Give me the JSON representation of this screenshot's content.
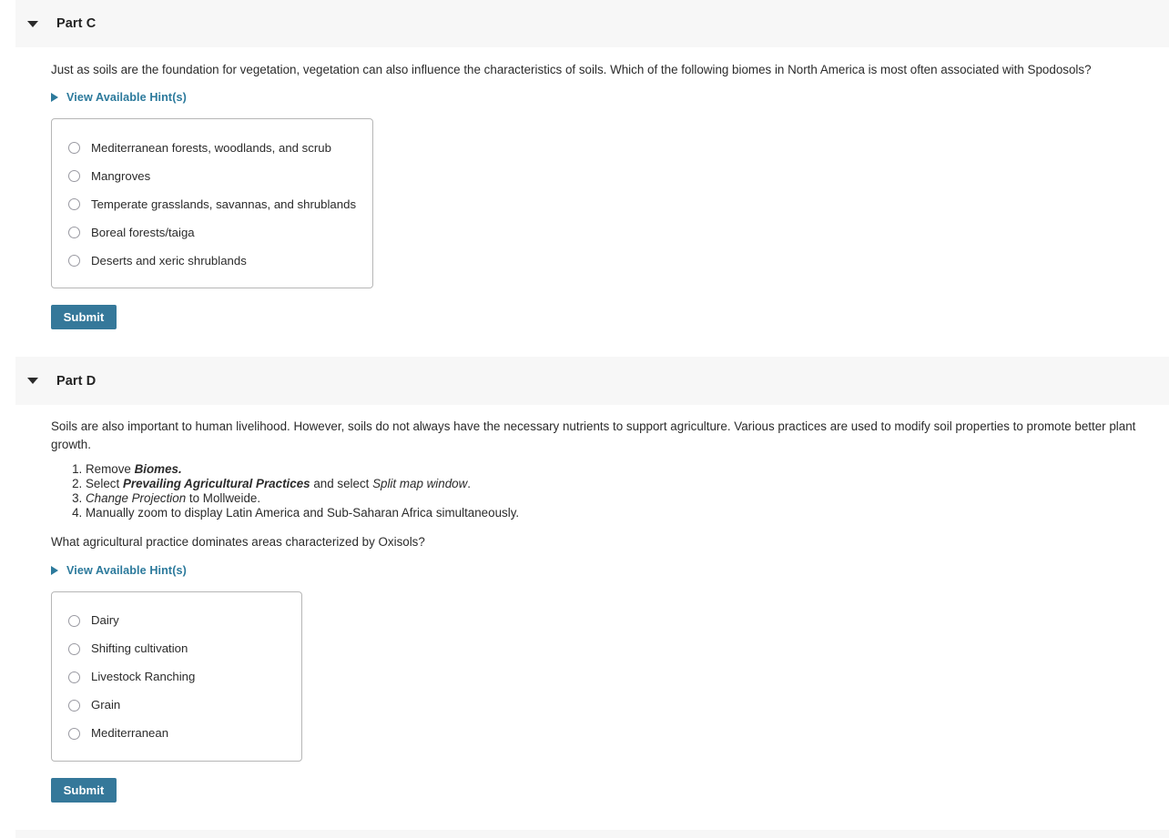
{
  "parts": [
    {
      "id": "part-c",
      "title": "Part C",
      "collapse_icon": "chevron-down-icon",
      "question": "Just as soils are the foundation for vegetation, vegetation can also influence the characteristics of soils. Which of the following biomes in North America is most often associated with Spodosols?",
      "hint": {
        "icon": "triangle-right-icon",
        "label": "View Available Hint(s)"
      },
      "options": [
        "Mediterranean forests, woodlands, and scrub",
        "Mangroves",
        "Temperate grasslands, savannas, and shrublands",
        "Boreal forests/taiga",
        "Deserts and xeric shrublands"
      ],
      "submit_label": "Submit"
    },
    {
      "id": "part-d",
      "title": "Part D",
      "collapse_icon": "chevron-down-icon",
      "intro": "Soils are also important to human livelihood. However, soils do not always have the necessary nutrients to support agriculture. Various practices are used to modify soil properties to promote better plant growth.",
      "instructions": [
        {
          "pre": "Remove ",
          "bold_italic": "Biomes.",
          "mid": "",
          "italic": "",
          "post": ""
        },
        {
          "pre": "Select ",
          "bold_italic": "Prevailing Agricultural Practices",
          "mid": " and select ",
          "italic": "Split map window",
          "post": "."
        },
        {
          "pre": "",
          "bold_italic": "",
          "mid": "",
          "italic": "Change Projection",
          "post": " to Mollweide."
        },
        {
          "pre": "Manually zoom to display Latin America and Sub-Saharan Africa simultaneously.",
          "bold_italic": "",
          "mid": "",
          "italic": "",
          "post": ""
        }
      ],
      "question": "What agricultural practice dominates areas characterized by Oxisols?",
      "hint": {
        "icon": "triangle-right-icon",
        "label": "View Available Hint(s)"
      },
      "options": [
        "Dairy",
        "Shifting cultivation",
        "Livestock Ranching",
        "Grain",
        "Mediterranean"
      ],
      "submit_label": "Submit"
    }
  ],
  "colors": {
    "header_bar": "#f7f7f7",
    "submit_button": "#35789a",
    "hint_link": "#2c7a9c",
    "option_border": "#b6b6b6",
    "radio_border": "#9a9aa2",
    "body_text": "#2b2b2b"
  }
}
